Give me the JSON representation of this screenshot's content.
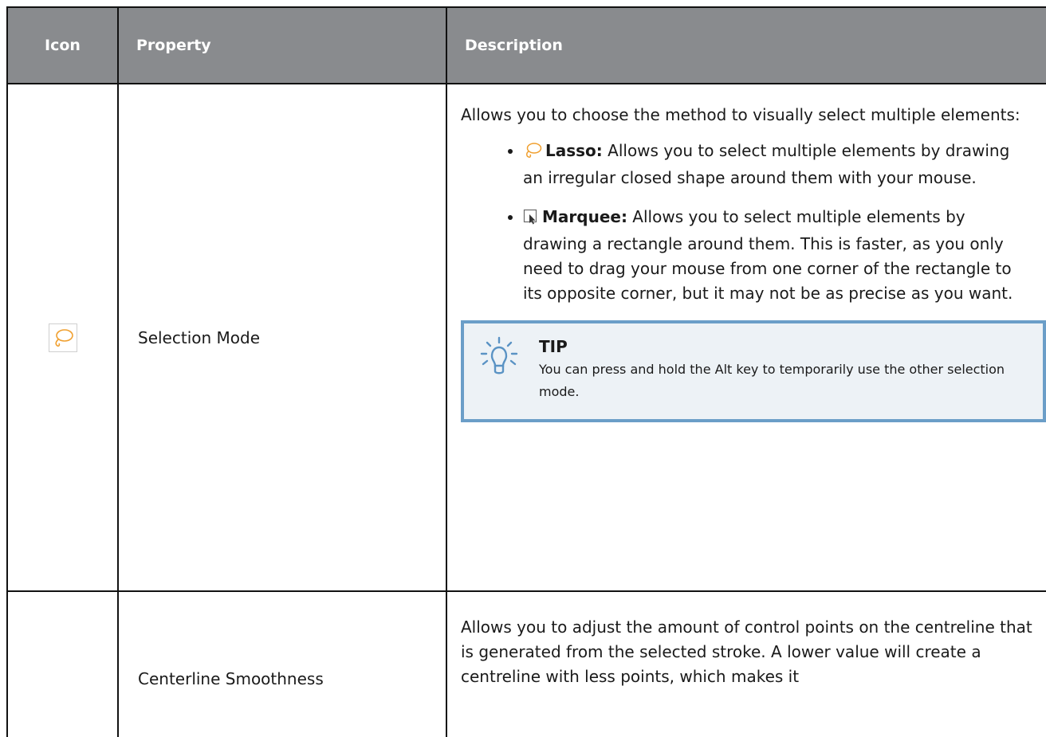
{
  "table": {
    "headers": {
      "icon": "Icon",
      "property": "Property",
      "description": "Description"
    },
    "rows": [
      {
        "icon_name": "lasso-icon",
        "property": "Selection Mode",
        "description_intro": "Allows you to choose the method to visually select multiple elements:",
        "options": [
          {
            "icon_name": "lasso-icon",
            "label": "Lasso:",
            "text": " Allows you to select multiple elements by drawing an irregular closed shape around them with your mouse."
          },
          {
            "icon_name": "marquee-icon",
            "label": "Marquee:",
            "text": " Allows you to select multiple elements by drawing a rectangle around them. This is faster, as you only need to drag your mouse from one corner of the rectangle to its opposite corner, but it may not be as precise as you want."
          }
        ],
        "tip": {
          "title": "TIP",
          "text": "You can press and hold the Alt key to temporarily use the other selection mode."
        }
      },
      {
        "property": "Centerline Smoothness",
        "description": "Allows you to adjust the amount of control points on the centreline that is generated from the selected stroke. A lower value will create a centreline with less points, which makes it"
      }
    ]
  },
  "colors": {
    "header_bg": "#898b8e",
    "header_text": "#ffffff",
    "tip_border": "#6b9ec8",
    "tip_bg": "#edf2f6",
    "lasso_orange": "#f0a030"
  }
}
